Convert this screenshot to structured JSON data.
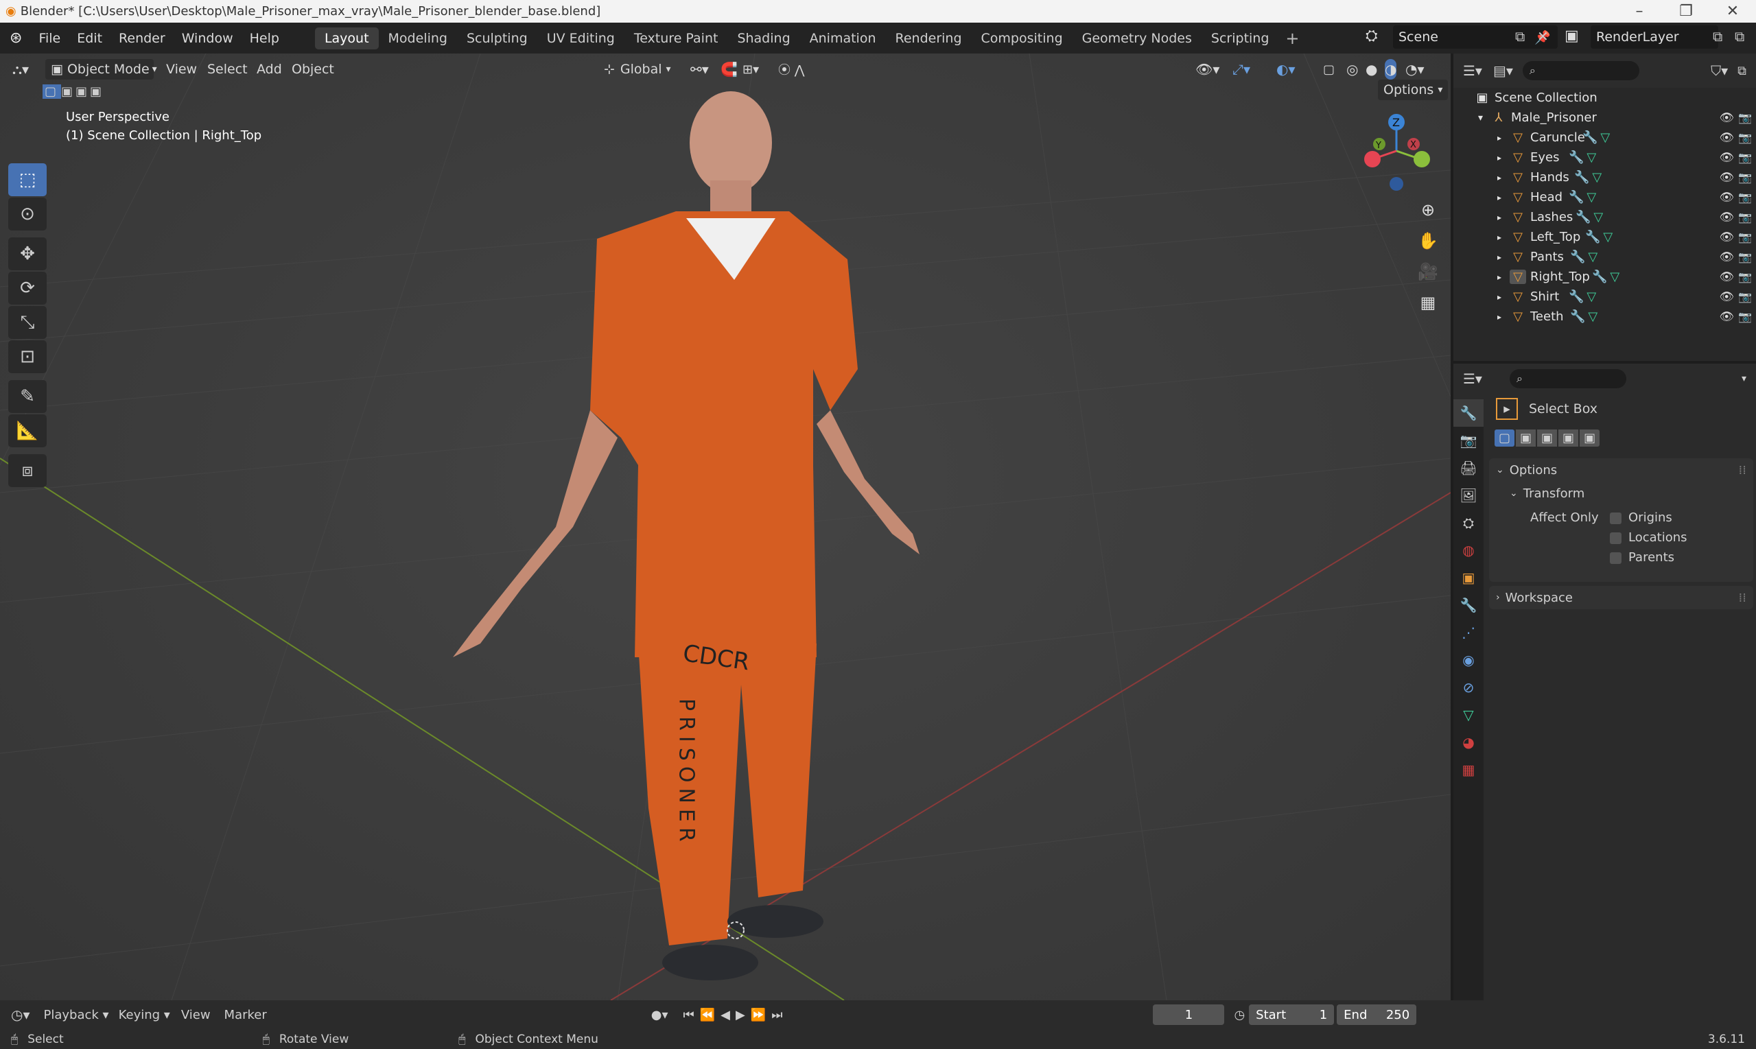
{
  "window_title": "Blender* [C:\\Users\\User\\Desktop\\Male_Prisoner_max_vray\\Male_Prisoner_blender_base.blend]",
  "menu": [
    "File",
    "Edit",
    "Render",
    "Window",
    "Help"
  ],
  "workspaces": [
    "Layout",
    "Modeling",
    "Sculpting",
    "UV Editing",
    "Texture Paint",
    "Shading",
    "Animation",
    "Rendering",
    "Compositing",
    "Geometry Nodes",
    "Scripting"
  ],
  "active_workspace": "Layout",
  "scene_name": "Scene",
  "render_layer": "RenderLayer",
  "viewport": {
    "mode": "Object Mode",
    "menus": [
      "View",
      "Select",
      "Add",
      "Object"
    ],
    "transform_orientation": "Global",
    "options_label": "Options",
    "perspective_label": "User Perspective",
    "collection_label": "(1) Scene Collection | Right_Top",
    "model_text_top": "CDCR",
    "model_text_side": "PRISONER"
  },
  "gizmo": {
    "z": "Z",
    "y": "Y",
    "x": "X"
  },
  "outliner": {
    "root": "Scene Collection",
    "collection": "Male_Prisoner",
    "objects": [
      "Caruncle",
      "Eyes",
      "Hands",
      "Head",
      "Lashes",
      "Left_Top",
      "Pants",
      "Right_Top",
      "Shirt",
      "Teeth"
    ]
  },
  "properties": {
    "tool_name": "Select Box",
    "options_label": "Options",
    "transform_label": "Transform",
    "affect_only_label": "Affect Only",
    "checkboxes": [
      "Origins",
      "Locations",
      "Parents"
    ],
    "workspace_label": "Workspace"
  },
  "timeline": {
    "menus": [
      "Playback",
      "Keying",
      "View",
      "Marker"
    ],
    "current_frame": "1",
    "start_label": "Start",
    "start_value": "1",
    "end_label": "End",
    "end_value": "250"
  },
  "status": {
    "select": "Select",
    "rotate": "Rotate View",
    "context": "Object Context Menu",
    "version": "3.6.11"
  },
  "colors": {
    "accent": "#4772b3",
    "orange": "#e3631f",
    "x_axis": "#e64553",
    "y_axis": "#8bbf3c",
    "z_axis": "#3b84d6"
  }
}
